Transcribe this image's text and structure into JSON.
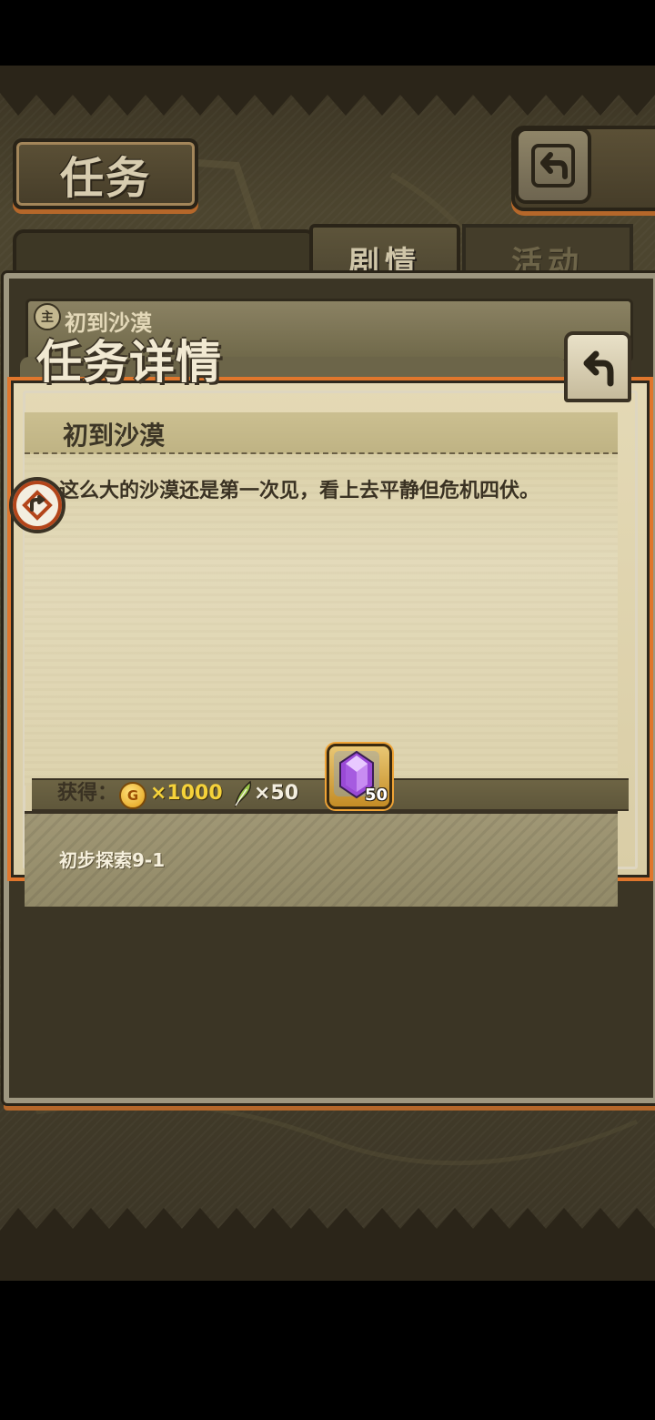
{
  "header": {
    "title": "任务"
  },
  "tabs": [
    {
      "label": "剧情",
      "active": true
    },
    {
      "label": "活动",
      "active": false
    }
  ],
  "list": {
    "badge": "主",
    "item_title": "初到沙漠"
  },
  "dialog": {
    "title": "任务详情",
    "quest_name": "初到沙漠",
    "description": "这么大的沙漠还是第一次见，看上去平静但危机四伏。",
    "reward_label": "获得：",
    "coin_symbol": "G",
    "coin_amount": "×1000",
    "feather_amount": "×50",
    "gem_count": "50",
    "task": "初步探索9-1"
  },
  "colors": {
    "accent_orange": "#e0762c",
    "coin_gold": "#f5d23a",
    "gem_purple": "#9a4ad6"
  },
  "icons": [
    "back-arrow-icon",
    "quest-marker-icon",
    "gold-coin-icon",
    "feather-icon",
    "purple-gem-icon"
  ]
}
